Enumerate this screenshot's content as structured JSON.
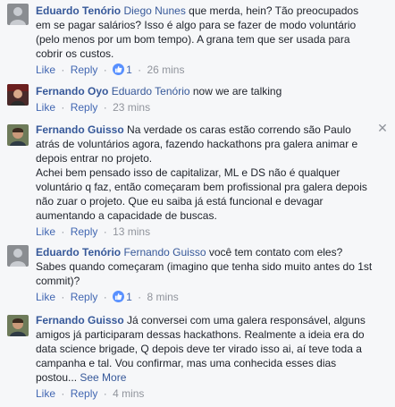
{
  "actions": {
    "like": "Like",
    "reply": "Reply",
    "separator": "·"
  },
  "comments": [
    {
      "author": "Eduardo Tenório",
      "mention": "Diego Nunes",
      "text": " que merda, hein? Tão preocupados em se pagar salários? Isso é algo para se fazer de modo voluntário (pelo menos por um bom tempo). A grana tem que ser usada para cobrir os custos.",
      "likes": "1",
      "time": "26 mins"
    },
    {
      "author": "Fernando Oyo",
      "mention": "Eduardo Tenório",
      "text": " now we are talking",
      "time": "23 mins"
    },
    {
      "author": "Fernando Guisso",
      "mention": "",
      "text": " Na verdade os caras estão correndo são Paulo atrás de voluntários agora, fazendo hackathons pra galera animar e depois entrar no projeto.",
      "text2": "Achei bem pensado isso de capitalizar, ML e DS não é qualquer voluntário q faz, então começaram bem profissional pra galera depois não zuar o projeto. Que eu saiba já está funcional e devagar aumentando a capacidade de buscas.",
      "time": "13 mins"
    },
    {
      "author": "Eduardo Tenório",
      "mention": "Fernando Guisso",
      "text": " você tem contato com eles? Sabes quando começaram (imagino que tenha sido muito antes do 1st commit)?",
      "likes": "1",
      "time": "8 mins"
    },
    {
      "author": "Fernando Guisso",
      "mention": "",
      "text": " Já conversei com uma galera responsável, alguns amigos já participaram dessas hackathons. Realmente a ideia era do data science brigade, Q depois deve ter virado isso ai, aí teve toda a campanha e tal. Vou confirmar, mas uma conhecida esses dias postou...",
      "see_more": "See More",
      "time": "4 mins"
    }
  ],
  "icons": {
    "like_badge": "thumbs-up-icon",
    "close": "close-icon"
  },
  "colors": {
    "author": "#365899",
    "link": "#4267b2",
    "muted": "#90949c",
    "background": "#f6f7f9",
    "like_badge": "#5890ff"
  }
}
